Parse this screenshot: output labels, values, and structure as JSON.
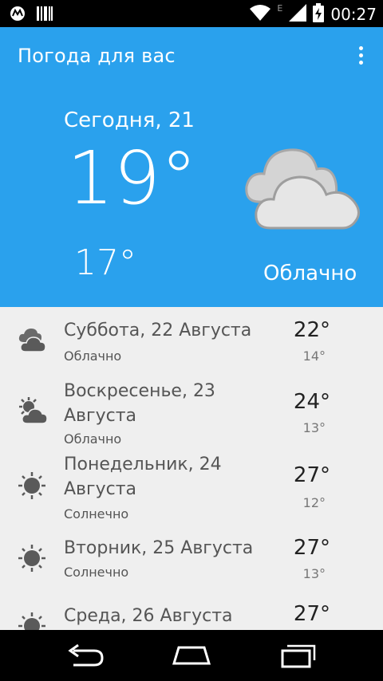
{
  "status_bar": {
    "time": "00:27",
    "network_letter": "E",
    "icons": [
      "motorola-icon",
      "barcode-icon",
      "wifi-icon",
      "signal-icon",
      "battery-charging-icon"
    ]
  },
  "app_bar": {
    "title": "Погода для вас",
    "overflow_icon": "more-vert-icon"
  },
  "today": {
    "label": "Сегодня, 21",
    "high": "19°",
    "low": "17°",
    "description": "Облачно",
    "icon": "cloudy-icon"
  },
  "forecast": [
    {
      "date": "Суббота, 22 Августа",
      "description": "Облачно",
      "high": "22°",
      "low": "14°",
      "icon": "cloudy-icon"
    },
    {
      "date": "Воскресенье, 23 Августа",
      "description": "Облачно",
      "high": "24°",
      "low": "13°",
      "icon": "partly-cloudy-icon"
    },
    {
      "date": "Понедельник, 24 Августа",
      "description": "Солнечно",
      "high": "27°",
      "low": "12°",
      "icon": "sunny-icon"
    },
    {
      "date": "Вторник, 25 Августа",
      "description": "Солнечно",
      "high": "27°",
      "low": "13°",
      "icon": "sunny-icon"
    },
    {
      "date": "Среда, 26 Августа",
      "description": "",
      "high": "27°",
      "low": "",
      "icon": "sunny-icon"
    }
  ],
  "nav_bar": {
    "buttons": [
      "back-icon",
      "home-icon",
      "recents-icon"
    ]
  },
  "colors": {
    "primary": "#2aa1ed",
    "list_background": "#efefef",
    "icon_gray": "#5a5a5a"
  }
}
